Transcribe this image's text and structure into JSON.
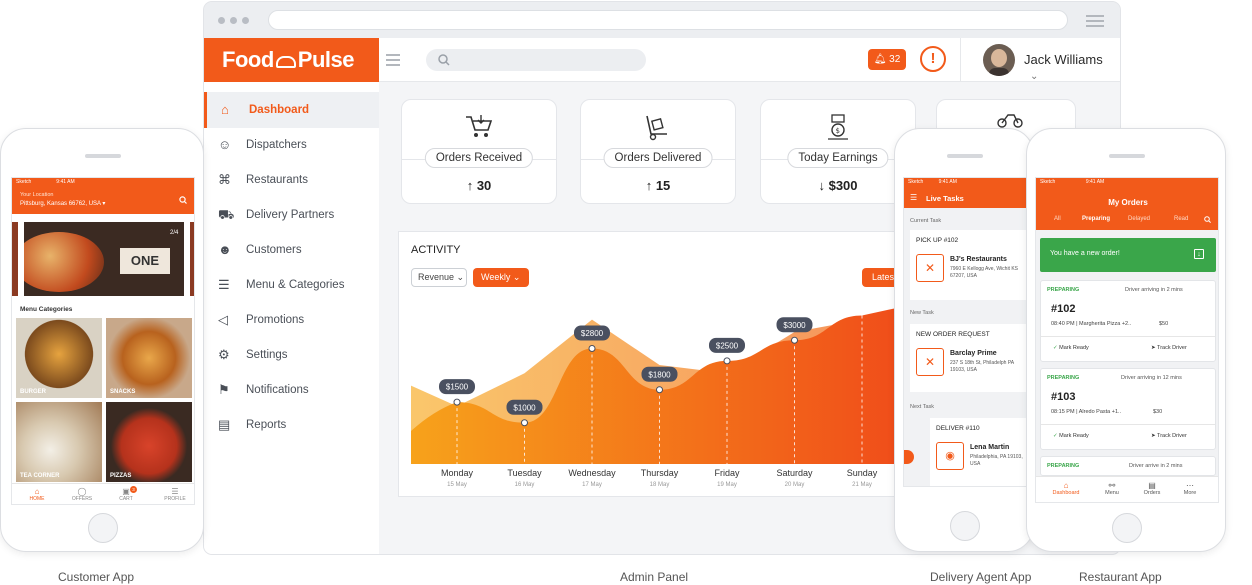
{
  "colors": {
    "accent": "#f25a1a",
    "success": "#3aa64a",
    "text": "#2a2a2a"
  },
  "admin": {
    "logo": "Food",
    "logo2": "Pulse",
    "notifications_count": "32",
    "user_name": "Jack Williams",
    "nav": [
      {
        "label": "Dashboard",
        "icon": "home-icon",
        "active": true
      },
      {
        "label": "Dispatchers",
        "icon": "dispatcher-icon"
      },
      {
        "label": "Restaurants",
        "icon": "restaurant-icon"
      },
      {
        "label": "Delivery Partners",
        "icon": "delivery-icon"
      },
      {
        "label": "Customers",
        "icon": "user-icon"
      },
      {
        "label": "Menu & Categories",
        "icon": "list-icon"
      },
      {
        "label": "Promotions",
        "icon": "megaphone-icon"
      },
      {
        "label": "Settings",
        "icon": "gear-icon"
      },
      {
        "label": "Notifications",
        "icon": "bell-icon"
      },
      {
        "label": "Reports",
        "icon": "report-icon"
      }
    ],
    "stats": [
      {
        "label": "Orders Received",
        "value": "30",
        "trend": "up",
        "icon": "cart-icon"
      },
      {
        "label": "Orders Delivered",
        "value": "15",
        "trend": "up",
        "icon": "trolley-icon"
      },
      {
        "label": "Today Earnings",
        "value": "$300",
        "trend": "down",
        "icon": "money-icon"
      }
    ],
    "activity": {
      "title": "ACTIVITY",
      "metric_select": "Revenue",
      "period_select": "Weekly",
      "latest_button": "Lates"
    }
  },
  "chart_data": {
    "type": "area",
    "title": "ACTIVITY",
    "categories": [
      "Monday",
      "Tuesday",
      "Wednesday",
      "Thursday",
      "Friday",
      "Saturday",
      "Sunday"
    ],
    "dates": [
      "15 May",
      "16 May",
      "17 May",
      "18 May",
      "19 May",
      "20 May",
      "21 May"
    ],
    "series": [
      {
        "values": [
          1500,
          1000,
          2800,
          1800,
          2500,
          3000,
          3600
        ],
        "labels": [
          "$1500",
          "$1000",
          "$2800",
          "$1800",
          "$2500",
          "$3000",
          ""
        ]
      }
    ],
    "ylim": [
      0,
      4000
    ],
    "grid": false
  },
  "customer": {
    "location_label": "Your Location",
    "location_value": "Pittsburg, Kansas 66762, USA",
    "banner_page": "2/4",
    "banner_text": "ONE",
    "categories_title": "Menu Categories",
    "tiles": [
      "BURGER",
      "SNACKS",
      "TEA CORNER",
      "PIZZAS"
    ],
    "tabs": [
      "HOME",
      "OFFERS",
      "CART",
      "PROFILE"
    ],
    "cart_badge": "3"
  },
  "agent": {
    "header": "Live Tasks",
    "current_label": "Current Task",
    "current_title": "PICK UP #102",
    "current_name": "BJ's Restaurants",
    "current_addr": "7960 E Kellogg Ave, Wichit KS 67207, USA",
    "new_label": "New Task",
    "new_title": "NEW ORDER REQUEST",
    "new_name": "Barclay Prime",
    "new_addr": "237 S 18th St, Philadelph PA 19103, USA",
    "next_label": "Next Task",
    "next_title": "DELIVER #110",
    "next_name": "Lena Martin",
    "next_addr": "Philadelphia, PA 19103, USA"
  },
  "restaurant": {
    "header": "My Orders",
    "tabs": [
      "All",
      "Preparing",
      "Delayed",
      "Read"
    ],
    "banner": "You have a new order!",
    "orders": [
      {
        "status": "PREPARING",
        "eta": "Driver arriving in 2 mins",
        "id": "#102",
        "detail": "08:40 PM | Margherita Pizza +2..",
        "price": "$50",
        "a1": "Mark Ready",
        "a2": "Track Driver"
      },
      {
        "status": "PREPARING",
        "eta": "Driver arriving in 12 mins",
        "id": "#103",
        "detail": "08:15 PM | Alredo Pasta +1..",
        "price": "$30",
        "a1": "Mark Ready",
        "a2": "Track Driver"
      },
      {
        "status": "PREPARING",
        "eta": "Driver arrive in 2 mins",
        "id": "",
        "detail": "",
        "price": "",
        "a1": "",
        "a2": ""
      }
    ],
    "nav": [
      "Dashboard",
      "Menu",
      "Orders",
      "More"
    ]
  },
  "captions": [
    "Customer App",
    "Admin Panel",
    "Delivery Agent App",
    "Restaurant App"
  ]
}
